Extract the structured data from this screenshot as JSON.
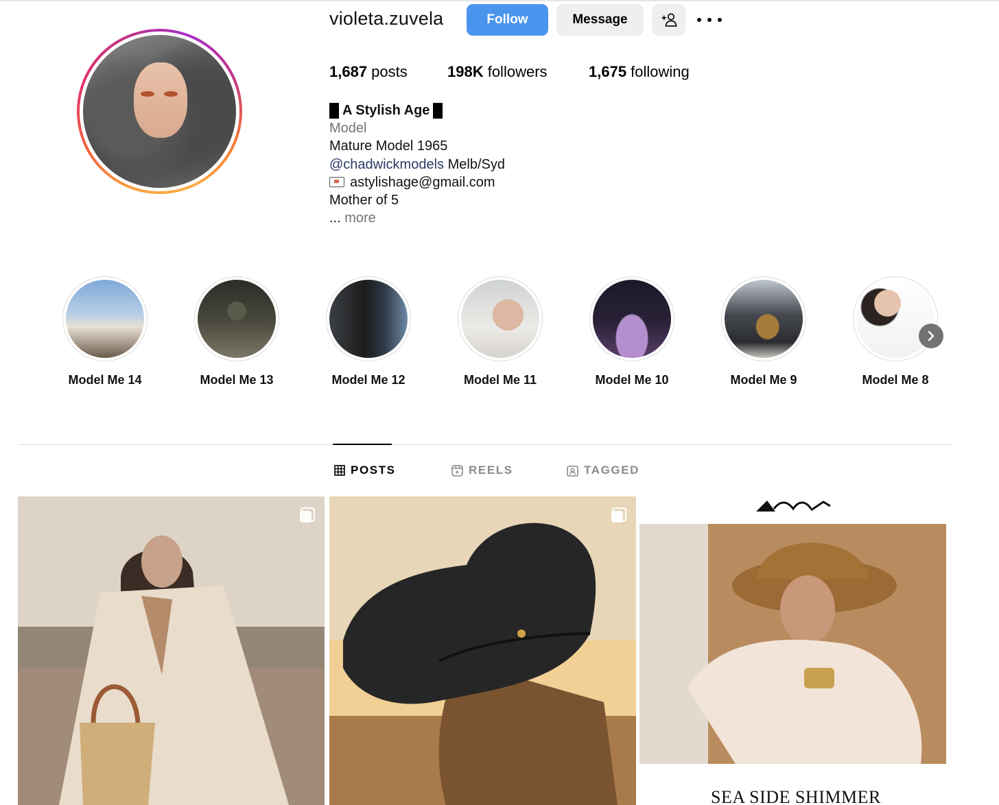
{
  "profile": {
    "username": "violeta.zuvela",
    "follow_label": "Follow",
    "message_label": "Message",
    "add_user_icon": "add-user-icon",
    "more_icon": "more-options-icon",
    "stats": {
      "posts_count": "1,687",
      "posts_label": " posts",
      "followers_count": "198K",
      "followers_label": " followers",
      "following_count": "1,675",
      "following_label": " following"
    },
    "bio": {
      "name": "A Stylish Age",
      "category": "Model",
      "line1": "Mature Model 1965",
      "mention": "@chadwickmodels",
      "mention_suffix": " Melb/Syd",
      "email": "astylishage@gmail.com",
      "line_mother": "Mother of 5",
      "more_prefix": "... ",
      "more_label": "more"
    }
  },
  "highlights": [
    {
      "label": "Model Me 14"
    },
    {
      "label": "Model Me 13"
    },
    {
      "label": "Model Me 12"
    },
    {
      "label": "Model Me 11"
    },
    {
      "label": "Model Me 10"
    },
    {
      "label": "Model Me 9"
    },
    {
      "label": "Model Me 8"
    }
  ],
  "tabs": [
    {
      "label": "POSTS",
      "icon": "grid-icon",
      "active": true
    },
    {
      "label": "REELS",
      "icon": "reels-icon",
      "active": false
    },
    {
      "label": "TAGGED",
      "icon": "tagged-icon",
      "active": false
    }
  ],
  "posts": {
    "post3_caption": "SEA SIDE SHIMMER"
  },
  "colors": {
    "follow_button": "#4a94ee",
    "secondary_button": "#efefef",
    "mention_link": "#2b3a68",
    "muted_text": "#737373"
  }
}
